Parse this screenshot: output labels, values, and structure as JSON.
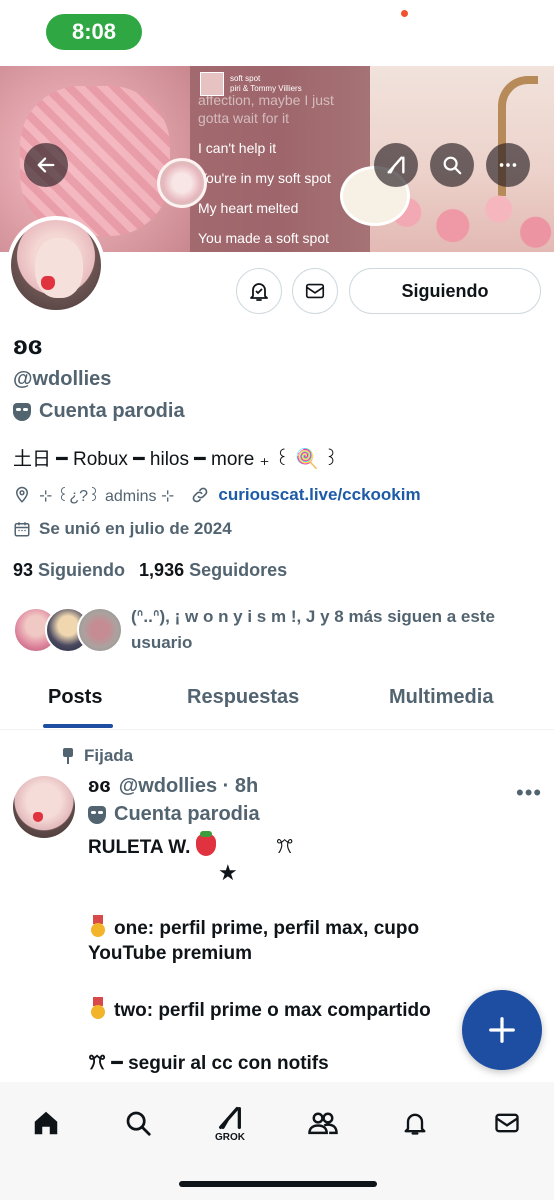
{
  "status_bar": {
    "time": "8:08"
  },
  "banner": {
    "song_title": "soft spot",
    "song_artists": "piri & Tommy Villiers",
    "lyrics": [
      "affection, maybe I just",
      "gotta wait for it",
      "I can't help it",
      "You're in my soft spot",
      "My heart melted",
      "You made a soft spot"
    ]
  },
  "profile": {
    "display_name": "ʚɞ",
    "handle": "@wdollies",
    "parody_label": "Cuenta parodia",
    "bio": "土日 ━ Robux ━ hilos ━ more ₊ ꒰ 🍭 ꒱",
    "location": "⊹ ꒰¿?꒱ admins ⊹",
    "website": "curiouscat.live/cckookim",
    "joined": "Se unió en julio de 2024",
    "following_count": "93",
    "following_label": "Siguiendo",
    "followers_count": "1,936",
    "followers_label": "Seguidores",
    "followed_by": "(ᐢ..ᐢ), ¡ w o n y i s m !, J y 8 más siguen a este usuario",
    "follow_button": "Siguiendo"
  },
  "tabs": [
    "Posts",
    "Respuestas",
    "Multimedia"
  ],
  "pinned_post": {
    "pinned_label": "Fijada",
    "name": "ʚɞ",
    "handle_time": "@wdollies · 8h",
    "parody_label": "Cuenta parodia",
    "line1": "RULETA W.",
    "line1_suffix": "ꔫ",
    "line2": "★",
    "line3": "one: perfil prime, perfil max, cupo",
    "line4": "YouTube premium",
    "line5": "two: perfil prime o max compartido",
    "line6": "ꔫ ━ seguir al cc con notifs"
  },
  "bottom_nav": {
    "grok_label": "GROK"
  },
  "colors": {
    "accent": "#1d4ea1",
    "link": "#1d5aa8",
    "secondary_text": "#536471",
    "status_pill": "#2fa844"
  }
}
